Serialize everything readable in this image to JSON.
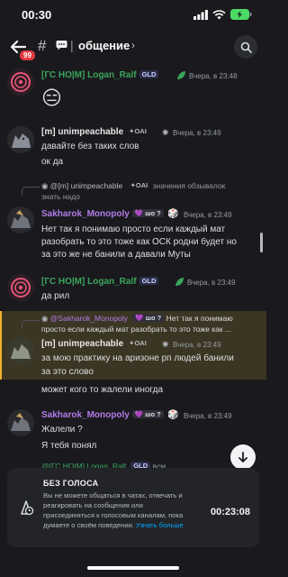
{
  "status": {
    "time": "00:30"
  },
  "header": {
    "badge": "99",
    "channel": "общение",
    "chevron": "›",
    "separator": "|"
  },
  "messages": [
    {
      "user": "[ГС НО|М] Logan_Ralf",
      "tag": "GLD",
      "time": "Вчера, в 23:48",
      "emoji": "😑"
    },
    {
      "user": "[m] unimpeachable",
      "tag": "OAI",
      "time": "Вчера, в 23:49",
      "lines": [
        "давайте без таких слов",
        "ок да"
      ]
    },
    {
      "reply": {
        "user": "@[m] unimpeachable",
        "tag": "OAI",
        "text": "значения обзывалок",
        "text2": "знать надо"
      },
      "user": "Sakharok_Monopoly",
      "tag": "шо ?",
      "time": "Вчера, в 23:49",
      "lines": [
        "Нет так я понимаю просто если каждый мат",
        "разобрать то это тоже как ОСК родни будет но",
        "за это же не банили а давали Муты"
      ]
    },
    {
      "user": "[ГС НО|М] Logan_Ralf",
      "tag": "GLD",
      "time": "Вчера, в 23:49",
      "lines": [
        "да рил"
      ]
    },
    {
      "reply": {
        "user": "@Sakharok_Monopoly",
        "tag": "шо ?",
        "text": "Нет так я понимаю",
        "text2": "просто если каждый мат разобрать то это тоже как ..."
      },
      "user": "[m] unimpeachable",
      "tag": "OAI",
      "time": "Вчера, в 23:49",
      "lines": [
        "за мою практику на аризоне рп людей банили",
        "за это слово",
        "может кого то жалели иногда"
      ]
    },
    {
      "user": "Sakharok_Monopoly",
      "tag": "шо ?",
      "time": "Вчера, в 23:49",
      "lines": [
        "Жалели ?",
        "Я тебя понял"
      ]
    },
    {
      "user": "@[ГС НО|М] Logan_Ralf",
      "tag": "GLD",
      "time": "всм"
    }
  ],
  "timeout": {
    "title": "БЕЗ ГОЛОСА",
    "text": "Вы не можете общаться в чатах, отвечать и реагировать на сообщения или присоединяться к голосовым каналам, пока думаете о своём поведении.",
    "link": "Узнать больше",
    "timer": "00:23:08"
  },
  "colors": {
    "green": "#3ba55c",
    "purple": "#b07ce8",
    "accent": "#00a8fc",
    "highlight": "#f0b232"
  }
}
